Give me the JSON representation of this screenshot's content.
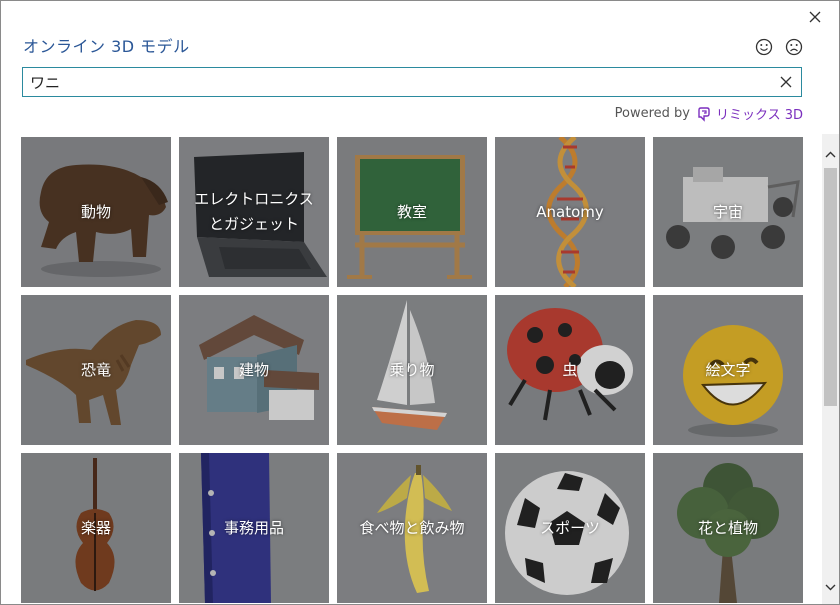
{
  "dialog": {
    "title": "オンライン 3D モデル",
    "close_icon": "close-icon",
    "feedback": {
      "happy_icon": "smiley-happy-icon",
      "sad_icon": "smiley-sad-icon"
    }
  },
  "search": {
    "value": "ワニ",
    "clear_icon": "clear-x-icon"
  },
  "powered_by": {
    "prefix": "Powered by",
    "brand": "リミックス 3D",
    "brand_color": "#7b2fbe"
  },
  "categories": [
    {
      "label": "動物",
      "image": "bear"
    },
    {
      "label": "エレクトロニクスとガジェット",
      "image": "laptop"
    },
    {
      "label": "教室",
      "image": "chalkboard"
    },
    {
      "label": "Anatomy",
      "image": "dna"
    },
    {
      "label": "宇宙",
      "image": "rover"
    },
    {
      "label": "恐竜",
      "image": "t-rex"
    },
    {
      "label": "建物",
      "image": "house"
    },
    {
      "label": "乗り物",
      "image": "sailboat"
    },
    {
      "label": "虫",
      "image": "ladybug"
    },
    {
      "label": "絵文字",
      "image": "smiley-emoji"
    },
    {
      "label": "楽器",
      "image": "violin"
    },
    {
      "label": "事務用品",
      "image": "binder"
    },
    {
      "label": "食べ物と飲み物",
      "image": "banana"
    },
    {
      "label": "スポーツ",
      "image": "soccer-ball"
    },
    {
      "label": "花と植物",
      "image": "tree"
    }
  ],
  "scrollbar": {
    "up_icon": "scroll-up-chevron-icon",
    "down_icon": "scroll-down-chevron-icon"
  }
}
